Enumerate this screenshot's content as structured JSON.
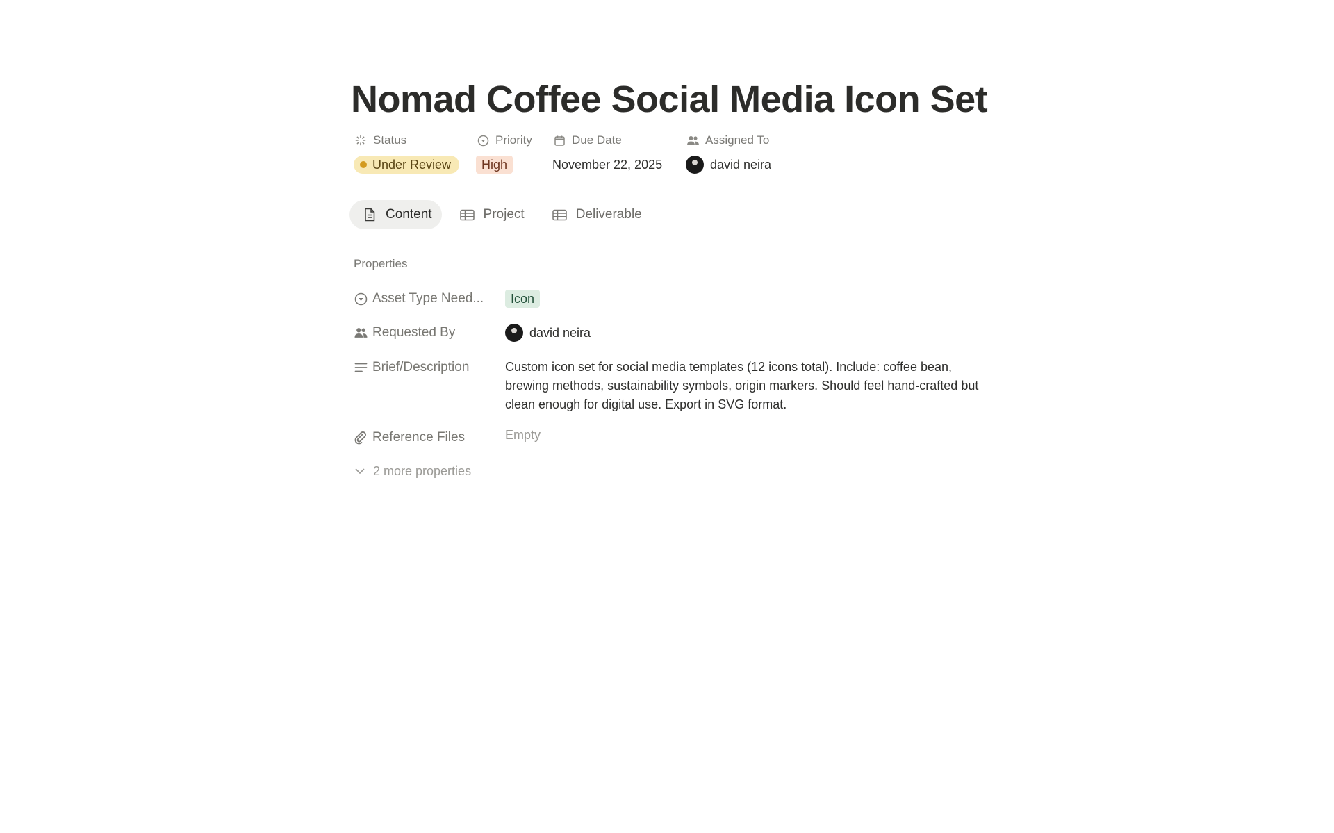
{
  "page": {
    "title": "Nomad Coffee Social Media Icon Set"
  },
  "header_properties": {
    "status": {
      "label": "Status",
      "value": "Under Review",
      "icon": "status-spinner-icon",
      "color": "#f8e9b5",
      "dot_color": "#d39b1f"
    },
    "priority": {
      "label": "Priority",
      "value": "High",
      "icon": "priority-circle-icon",
      "color": "#fae0d2"
    },
    "due_date": {
      "label": "Due Date",
      "value": "November 22, 2025",
      "icon": "calendar-icon"
    },
    "assigned_to": {
      "label": "Assigned To",
      "value": "david neira",
      "icon": "people-icon"
    }
  },
  "tabs": [
    {
      "label": "Content",
      "icon": "document-icon",
      "active": true
    },
    {
      "label": "Project",
      "icon": "table-icon",
      "active": false
    },
    {
      "label": "Deliverable",
      "icon": "table-icon",
      "active": false
    }
  ],
  "properties": {
    "section_label": "Properties",
    "asset_type": {
      "label": "Asset Type Need...",
      "value": "Icon",
      "icon": "select-circle-icon",
      "color": "#dcece1"
    },
    "requested_by": {
      "label": "Requested By",
      "value": "david neira",
      "icon": "people-icon"
    },
    "brief": {
      "label": "Brief/Description",
      "value": "Custom icon set for social media templates (12 icons total). Include: coffee bean, brewing methods, sustainability symbols, origin markers. Should feel hand-crafted but clean enough for digital use. Export in SVG format.",
      "icon": "text-lines-icon"
    },
    "reference_files": {
      "label": "Reference Files",
      "value": "Empty",
      "icon": "paperclip-icon"
    },
    "more_label": "2 more properties"
  }
}
